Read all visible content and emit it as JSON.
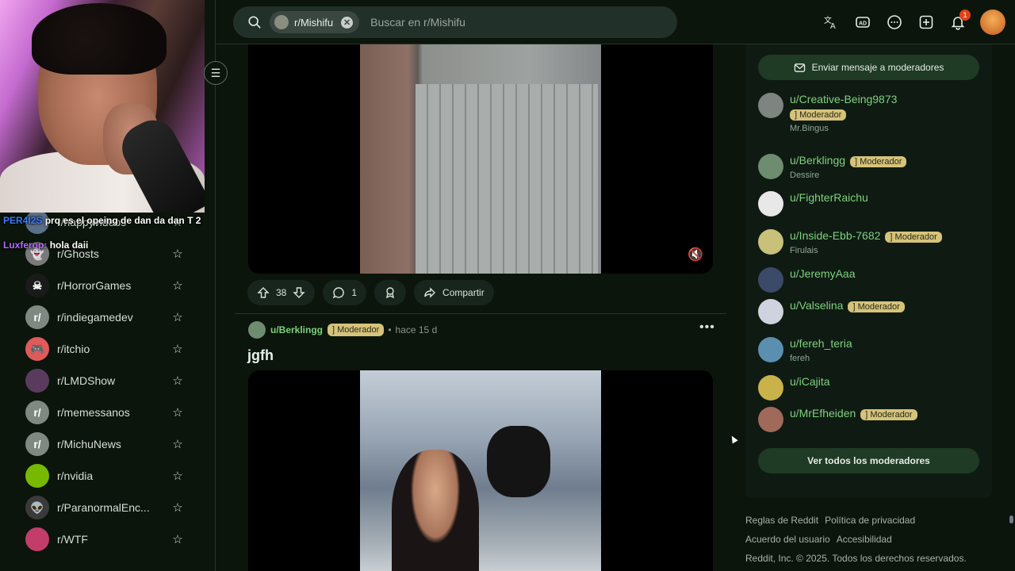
{
  "chat": {
    "messages": [
      {
        "user": "PER4I2S",
        "text": "prq es el opeing de dan da dan T 2"
      },
      {
        "user": "Luxferop:",
        "text": "hola daii"
      }
    ]
  },
  "search": {
    "chip_label": "r/Mishifu",
    "placeholder": "Buscar en r/Mishifu"
  },
  "header": {
    "notification_count": "1",
    "icons": [
      "translate-icon",
      "advertise-icon",
      "chat-icon",
      "create-post-icon",
      "notifications-icon"
    ]
  },
  "sidebar": {
    "subreddits": [
      {
        "name": "r/happyvideos",
        "color": "#5b6f88",
        "glyph": ""
      },
      {
        "name": "r/Ghosts",
        "color": "#7a7a7a",
        "glyph": "👻"
      },
      {
        "name": "r/HorrorGames",
        "color": "#1a1a1a",
        "glyph": "☠"
      },
      {
        "name": "r/indiegamedev",
        "color": "#7f8881",
        "glyph": "r/"
      },
      {
        "name": "r/itchio",
        "color": "#e05a5a",
        "glyph": "🎮"
      },
      {
        "name": "r/LMDShow",
        "color": "#5a3b5e",
        "glyph": ""
      },
      {
        "name": "r/memessanos",
        "color": "#7f8881",
        "glyph": "r/"
      },
      {
        "name": "r/MichuNews",
        "color": "#7f8881",
        "glyph": "r/"
      },
      {
        "name": "r/nvidia",
        "color": "#76b900",
        "glyph": ""
      },
      {
        "name": "r/ParanormalEnc...",
        "color": "#3a3a3a",
        "glyph": "👽"
      },
      {
        "name": "r/WTF",
        "color": "#c23d6a",
        "glyph": ""
      }
    ]
  },
  "post1": {
    "votes": "38",
    "comments": "1",
    "share_label": "Compartir"
  },
  "post2": {
    "author": "u/Berklingg",
    "flair": "] Moderador",
    "time": "hace 15 d",
    "title": "jgfh"
  },
  "moderators": {
    "message_button": "Enviar mensaje a moderadores",
    "view_all_button": "Ver todos los moderadores",
    "list": [
      {
        "name": "u/Creative-Being9873",
        "flair": "] Moderador",
        "sub": "Mr.Bingus",
        "color": "#7e8480"
      },
      {
        "name": "u/Berklingg",
        "flair": "] Moderador",
        "sub": "Dessire",
        "color": "#6e8c70"
      },
      {
        "name": "u/FighterRaichu",
        "flair": "",
        "sub": "",
        "color": "#e8e8e8"
      },
      {
        "name": "u/Inside-Ebb-7682",
        "flair": "] Moderador",
        "sub": "Firulais",
        "color": "#c9c07a"
      },
      {
        "name": "u/JeremyAaa",
        "flair": "",
        "sub": "",
        "color": "#3c4a6a"
      },
      {
        "name": "u/Valselina",
        "flair": "] Moderador",
        "sub": "",
        "color": "#cfd3e0"
      },
      {
        "name": "u/fereh_teria",
        "flair": "",
        "sub": "fereh",
        "color": "#5a8fb0"
      },
      {
        "name": "u/iCajita",
        "flair": "",
        "sub": "",
        "color": "#c9b24a"
      },
      {
        "name": "u/MrEfheiden",
        "flair": "] Moderador",
        "sub": "",
        "color": "#a06a5a"
      }
    ]
  },
  "footer": {
    "links": [
      "Reglas de Reddit",
      "Política de privacidad",
      "Acuerdo del usuario",
      "Accesibilidad"
    ],
    "copyright": "Reddit, Inc. © 2025. Todos los derechos reservados."
  }
}
